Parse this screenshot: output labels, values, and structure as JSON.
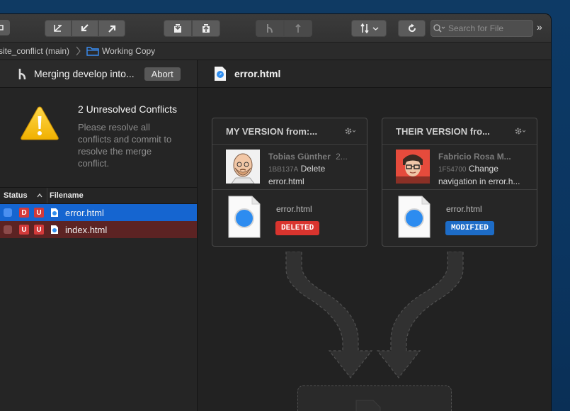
{
  "toolbar": {
    "search_placeholder": "Search for File",
    "more": "»"
  },
  "breadcrumb": {
    "repo": "site_conflict (main)",
    "location": "Working Copy"
  },
  "merge": {
    "text": "Merging develop into...",
    "abort_label": "Abort"
  },
  "conflicts": {
    "title": "2 Unresolved Conflicts",
    "message": "Please resolve all conflicts and commit to resolve the merge conflict."
  },
  "file_list": {
    "headers": {
      "status": "Status",
      "filename": "Filename"
    },
    "rows": [
      {
        "status_a": "D",
        "status_b": "U",
        "name": "error.html"
      },
      {
        "status_a": "U",
        "status_b": "U",
        "name": "index.html"
      }
    ]
  },
  "detail": {
    "filename": "error.html"
  },
  "my_version": {
    "title": "MY VERSION from:...",
    "author": "Tobias Günther",
    "author_suffix": "2...",
    "hash": "1BB137A",
    "message_a": "Delete",
    "message_b": "error.html",
    "file": "error.html",
    "status": "DELETED",
    "status_color": "#d9342e"
  },
  "their_version": {
    "title": "THEIR VERSION fro...",
    "author": "Fabricio Rosa M...",
    "hash": "1F54700",
    "message_a": "Change",
    "message_b": "navigation in error.h...",
    "file": "error.html",
    "status": "MODIFIED",
    "status_color": "#1d6cc7"
  },
  "colors": {
    "selected_row": "#1565d0",
    "conflict_row": "#5c2323",
    "accent_blue": "#1e7cf2"
  }
}
